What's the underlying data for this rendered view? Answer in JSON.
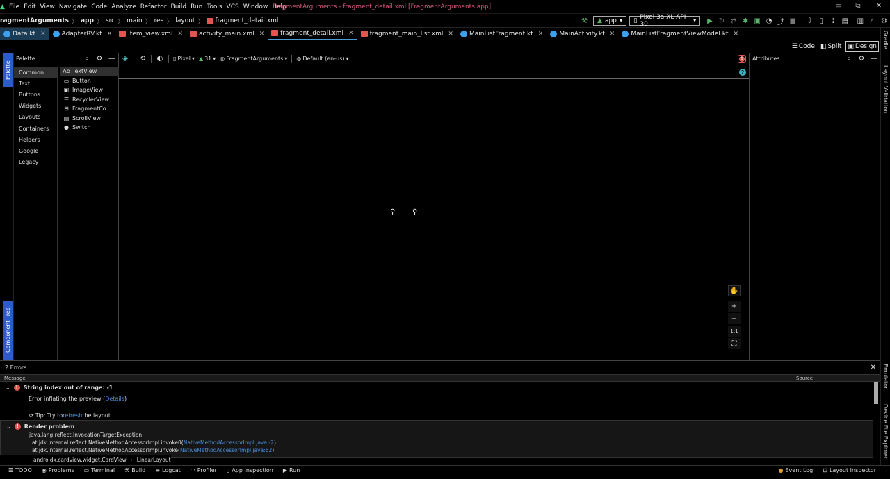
{
  "menubar": {
    "items": [
      "File",
      "Edit",
      "View",
      "Navigate",
      "Code",
      "Analyze",
      "Refactor",
      "Build",
      "Run",
      "Tools",
      "VCS",
      "Window",
      "Help"
    ],
    "window_title": "FragmentArguments - fragment_detail.xml [FragmentArguments.app]"
  },
  "breadcrumb": {
    "items": [
      "ragmentArguments",
      "app",
      "src",
      "main",
      "res",
      "layout",
      "fragment_detail.xml"
    ]
  },
  "run_config": {
    "module": "app",
    "device": "Pixel 3a XL API 30"
  },
  "tabs": [
    {
      "label": "Data.kt",
      "type": "kt"
    },
    {
      "label": "AdapterRV.kt",
      "type": "kt"
    },
    {
      "label": "item_view.xml",
      "type": "xml"
    },
    {
      "label": "activity_main.xml",
      "type": "xml"
    },
    {
      "label": "fragment_detail.xml",
      "type": "xml"
    },
    {
      "label": "fragment_main_list.xml",
      "type": "xml"
    },
    {
      "label": "MainListFragment.kt",
      "type": "kt"
    },
    {
      "label": "MainActivity.kt",
      "type": "kt"
    },
    {
      "label": "MainListFragmentViewModel.kt",
      "type": "kt"
    }
  ],
  "view_switch": {
    "code": "Code",
    "split": "Split",
    "design": "Design"
  },
  "right_gutter": {
    "gradle": "Gradle",
    "layout_validation": "Layout Validation",
    "emulator": "Emulator",
    "device_file_explorer": "Device File Explorer"
  },
  "left_gutter": {
    "palette": "Palette",
    "component_tree": "Component Tree"
  },
  "palette": {
    "title": "Palette",
    "categories": [
      "Common",
      "Text",
      "Buttons",
      "Widgets",
      "Layouts",
      "Containers",
      "Helpers",
      "Google",
      "Legacy"
    ],
    "items": [
      {
        "icon": "Ab",
        "label": "TextView"
      },
      {
        "icon": "▭",
        "label": "Button"
      },
      {
        "icon": "▣",
        "label": "ImageView"
      },
      {
        "icon": "☰",
        "label": "RecyclerView"
      },
      {
        "icon": "⊟",
        "label": "FragmentCo..."
      },
      {
        "icon": "▤",
        "label": "ScrollView"
      },
      {
        "icon": "●",
        "label": "Switch"
      }
    ]
  },
  "design_toolbar": {
    "device": "Pixel",
    "api": "31",
    "theme": "FragmentArguments",
    "locale": "Default (en-us)"
  },
  "attributes": {
    "title": "Attributes"
  },
  "errors": {
    "title": "2 Errors",
    "col_message": "Message",
    "col_source": "Source",
    "error1_title": "String index out of range: -1",
    "error1_detail_prefix": "Error inflating the preview (",
    "error1_detail_link": "Details",
    "error1_detail_suffix": ")",
    "tip_prefix": "Tip: Try to ",
    "tip_link": "refresh",
    "tip_suffix": " the layout.",
    "error2_title": "Render problem",
    "trace0": "java.lang.reflect.InvocationTargetException",
    "trace1_text": "at jdk.internal.reflect.NativeMethodAccessorImpl.invoke0(",
    "trace1_link": "NativeMethodAccessorImpl.java:-2",
    "trace2_text": "at jdk.internal.reflect.NativeMethodAccessorImpl.invoke(",
    "trace2_link": "NativeMethodAccessorImpl.java:62",
    "path1": "androidx.cardview.widget.CardView",
    "path2": "LinearLayout"
  },
  "statusbar": {
    "items": [
      "TODO",
      "Problems",
      "Terminal",
      "Build",
      "Logcat",
      "Profiler",
      "App Inspection",
      "Run"
    ],
    "right_items": [
      "Event Log",
      "Layout Inspector"
    ]
  },
  "colors": {
    "accent": "#4a9bd8",
    "title": "#d5557a",
    "error": "#e0574f",
    "palette_tab": "#2c5cc9"
  }
}
